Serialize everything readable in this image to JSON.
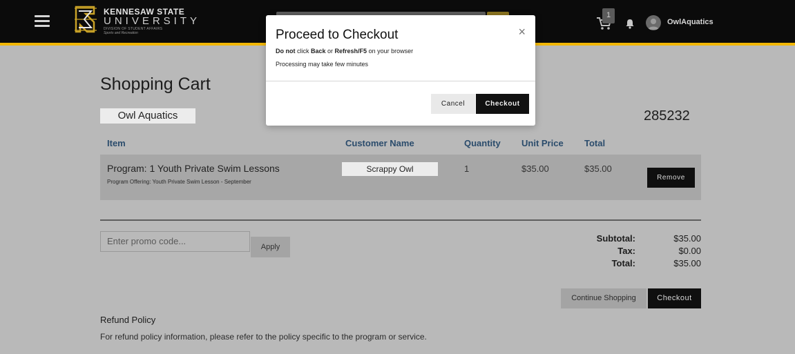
{
  "navbar": {
    "logo": {
      "line1": "KENNESAW STATE",
      "line2": "UNIVERSITY",
      "line3": "DIVISION OF STUDENT AFFAIRS",
      "line4": "Sports and Recreation"
    },
    "cart_count": "1",
    "username": "OwlAquatics",
    "colors": {
      "accent": "#f2b705",
      "bar": "#0b0b0b"
    }
  },
  "page": {
    "title": "Shopping Cart",
    "tab_label": "Owl Aquatics",
    "order_number": "285232"
  },
  "table": {
    "headers": {
      "item": "Item",
      "customer_name": "Customer Name",
      "quantity": "Quantity",
      "unit_price": "Unit Price",
      "total": "Total"
    },
    "row": {
      "item_title": "Program: 1 Youth Private Swim Lessons",
      "item_subtitle": "Program Offering: Youth Private Swim Lesson - September",
      "customer_name": "Scrappy Owl",
      "quantity": "1",
      "unit_price": "$35.00",
      "total": "$35.00",
      "remove_label": "Remove"
    }
  },
  "promo": {
    "placeholder": "Enter promo code...",
    "apply_label": "Apply"
  },
  "totals": {
    "subtotal_label": "Subtotal:",
    "subtotal_value": "$35.00",
    "tax_label": "Tax:",
    "tax_value": "$0.00",
    "total_label": "Total:",
    "total_value": "$35.00"
  },
  "actions": {
    "continue_label": "Continue Shopping",
    "checkout_label": "Checkout"
  },
  "refund": {
    "title": "Refund Policy",
    "text": "For refund policy information, please refer to the policy specific to the program or service."
  },
  "modal": {
    "title": "Proceed to Checkout",
    "close_glyph": "×",
    "line1_bold_a": "Do not",
    "line1_text_a": " click ",
    "line1_bold_b": "Back",
    "line1_text_b": " or ",
    "line1_bold_c": "Refresh/F5",
    "line1_text_c": " on your browser",
    "line2": "Processing may take few minutes",
    "cancel_label": "Cancel",
    "checkout_label": "Checkout"
  }
}
